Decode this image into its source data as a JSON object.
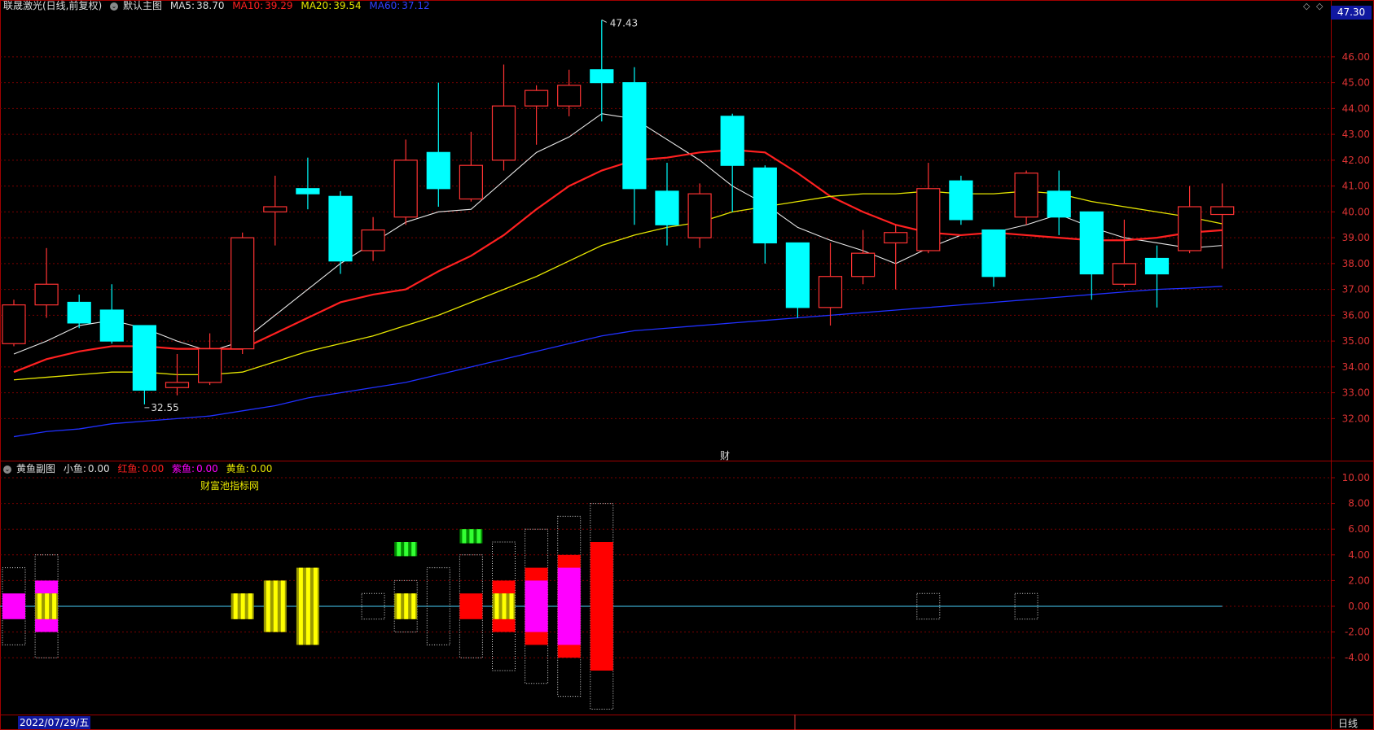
{
  "main_header": {
    "stock": "联晟激光(日线,前复权)",
    "panel": "默认主图",
    "ma5_label": "MA5:",
    "ma5": "38.70",
    "ma10_label": "MA10:",
    "ma10": "39.29",
    "ma20_label": "MA20:",
    "ma20": "39.54",
    "ma60_label": "MA60:",
    "ma60": "37.12"
  },
  "price_box": "47.30",
  "sub_header": {
    "panel": "黄鱼副图",
    "small_label": "小鱼:",
    "small": "0.00",
    "red_label": "红鱼:",
    "red": "0.00",
    "purple_label": "紫鱼:",
    "purple": "0.00",
    "yellow_label": "黄鱼:",
    "yellow": "0.00"
  },
  "sub_note": "财富池指标网",
  "cai_marker": "财",
  "date_label": "2022/07/29/五",
  "period_label": "日线",
  "colors": {
    "up": "#ff3333",
    "down": "#00ffff",
    "ma5": "#e8e8e8",
    "ma10": "#ff2020",
    "ma20": "#e6e600",
    "ma60": "#2030ff",
    "grid": "#7a0000",
    "border": "#a00000",
    "fish_yellow": "#e6e600",
    "fish_magenta": "#ff00ff",
    "fish_red": "#ff0000",
    "fish_green": "#00cc00"
  },
  "chart_data": [
    {
      "type": "candlestick",
      "title": "默认主图",
      "ylim": [
        31.0,
        47.43
      ],
      "y_ticks": [
        "32.00",
        "33.00",
        "34.00",
        "35.00",
        "36.00",
        "37.00",
        "38.00",
        "39.00",
        "40.00",
        "41.00",
        "42.00",
        "43.00",
        "44.00",
        "45.00",
        "46.00"
      ],
      "high_annotation": "47.43",
      "low_annotation": "32.55",
      "candles": [
        {
          "o": 34.9,
          "c": 36.4,
          "h": 36.6,
          "l": 34.8
        },
        {
          "o": 36.4,
          "c": 37.2,
          "h": 38.6,
          "l": 35.9
        },
        {
          "o": 36.5,
          "c": 35.7,
          "h": 36.8,
          "l": 35.5
        },
        {
          "o": 36.2,
          "c": 35.0,
          "h": 37.2,
          "l": 34.9
        },
        {
          "o": 35.6,
          "c": 33.1,
          "h": 35.6,
          "l": 32.55
        },
        {
          "o": 33.2,
          "c": 33.4,
          "h": 34.5,
          "l": 32.9
        },
        {
          "o": 33.4,
          "c": 34.7,
          "h": 35.3,
          "l": 33.3
        },
        {
          "o": 34.7,
          "c": 39.0,
          "h": 39.2,
          "l": 34.5
        },
        {
          "o": 40.0,
          "c": 40.2,
          "h": 41.4,
          "l": 38.7
        },
        {
          "o": 40.9,
          "c": 40.7,
          "h": 42.1,
          "l": 40.1
        },
        {
          "o": 40.6,
          "c": 38.1,
          "h": 40.8,
          "l": 37.6
        },
        {
          "o": 38.5,
          "c": 39.3,
          "h": 39.8,
          "l": 38.1
        },
        {
          "o": 39.8,
          "c": 42.0,
          "h": 42.8,
          "l": 39.5
        },
        {
          "o": 42.3,
          "c": 40.9,
          "h": 45.0,
          "l": 40.2
        },
        {
          "o": 40.5,
          "c": 41.8,
          "h": 43.1,
          "l": 40.4
        },
        {
          "o": 42.0,
          "c": 44.1,
          "h": 45.7,
          "l": 41.6
        },
        {
          "o": 44.1,
          "c": 44.7,
          "h": 44.9,
          "l": 42.6
        },
        {
          "o": 44.1,
          "c": 44.9,
          "h": 45.5,
          "l": 43.7
        },
        {
          "o": 45.5,
          "c": 45.0,
          "h": 47.43,
          "l": 43.5
        },
        {
          "o": 45.0,
          "c": 40.9,
          "h": 45.6,
          "l": 39.5
        },
        {
          "o": 40.8,
          "c": 39.5,
          "h": 41.9,
          "l": 38.7
        },
        {
          "o": 39.0,
          "c": 40.7,
          "h": 41.1,
          "l": 38.6
        },
        {
          "o": 43.7,
          "c": 41.8,
          "h": 43.8,
          "l": 40.0
        },
        {
          "o": 41.7,
          "c": 38.8,
          "h": 41.8,
          "l": 38.0
        },
        {
          "o": 38.8,
          "c": 36.3,
          "h": 38.8,
          "l": 35.9
        },
        {
          "o": 36.3,
          "c": 37.5,
          "h": 38.8,
          "l": 35.6
        },
        {
          "o": 37.5,
          "c": 38.4,
          "h": 39.3,
          "l": 37.2
        },
        {
          "o": 38.8,
          "c": 39.2,
          "h": 39.5,
          "l": 37.0
        },
        {
          "o": 38.5,
          "c": 40.9,
          "h": 41.9,
          "l": 38.4
        },
        {
          "o": 41.2,
          "c": 39.7,
          "h": 41.4,
          "l": 39.5
        },
        {
          "o": 39.3,
          "c": 37.5,
          "h": 39.3,
          "l": 37.1
        },
        {
          "o": 39.8,
          "c": 41.5,
          "h": 41.6,
          "l": 39.5
        },
        {
          "o": 40.8,
          "c": 39.8,
          "h": 41.6,
          "l": 39.1
        },
        {
          "o": 40.0,
          "c": 37.6,
          "h": 40.0,
          "l": 36.6
        },
        {
          "o": 37.2,
          "c": 38.0,
          "h": 39.7,
          "l": 37.1
        },
        {
          "o": 38.2,
          "c": 37.6,
          "h": 38.7,
          "l": 36.3
        },
        {
          "o": 38.5,
          "c": 40.2,
          "h": 41.0,
          "l": 38.4
        },
        {
          "o": 39.9,
          "c": 40.2,
          "h": 41.1,
          "l": 37.8
        }
      ],
      "series": [
        {
          "name": "MA5",
          "key": "ma5",
          "values": [
            34.5,
            35.0,
            35.6,
            35.8,
            35.5,
            35.0,
            34.6,
            35.0,
            36.0,
            37.0,
            38.0,
            38.8,
            39.6,
            40.0,
            40.1,
            41.2,
            42.3,
            42.9,
            43.8,
            43.6,
            42.8,
            42.0,
            41.0,
            40.3,
            39.4,
            38.9,
            38.5,
            38.0,
            38.6,
            39.1,
            39.2,
            39.5,
            39.9,
            39.4,
            39.0,
            38.8,
            38.6,
            38.7
          ]
        },
        {
          "name": "MA10",
          "key": "ma10",
          "values": [
            33.8,
            34.3,
            34.6,
            34.8,
            34.8,
            34.7,
            34.7,
            34.7,
            35.3,
            35.9,
            36.5,
            36.8,
            37.0,
            37.7,
            38.3,
            39.1,
            40.1,
            41.0,
            41.6,
            42.0,
            42.1,
            42.3,
            42.4,
            42.3,
            41.5,
            40.6,
            40.0,
            39.5,
            39.2,
            39.1,
            39.2,
            39.1,
            39.0,
            38.9,
            38.9,
            39.0,
            39.2,
            39.29
          ]
        },
        {
          "name": "MA20",
          "key": "ma20",
          "values": [
            33.5,
            33.6,
            33.7,
            33.8,
            33.8,
            33.7,
            33.7,
            33.8,
            34.2,
            34.6,
            34.9,
            35.2,
            35.6,
            36.0,
            36.5,
            37.0,
            37.5,
            38.1,
            38.7,
            39.1,
            39.4,
            39.6,
            40.0,
            40.2,
            40.4,
            40.6,
            40.7,
            40.7,
            40.8,
            40.7,
            40.7,
            40.8,
            40.7,
            40.4,
            40.2,
            40.0,
            39.8,
            39.54
          ]
        },
        {
          "name": "MA60",
          "key": "ma60",
          "values": [
            31.3,
            31.5,
            31.6,
            31.8,
            31.9,
            32.0,
            32.1,
            32.3,
            32.5,
            32.8,
            33.0,
            33.2,
            33.4,
            33.7,
            34.0,
            34.3,
            34.6,
            34.9,
            35.2,
            35.4,
            35.5,
            35.6,
            35.7,
            35.8,
            35.9,
            36.0,
            36.1,
            36.2,
            36.3,
            36.4,
            36.5,
            36.6,
            36.7,
            36.8,
            36.9,
            37.0,
            37.05,
            37.12
          ]
        }
      ]
    },
    {
      "type": "bar",
      "title": "黄鱼副图",
      "ylim": [
        -6.5,
        11.5
      ],
      "y_ticks": [
        "-4.00",
        "-2.00",
        "0.00",
        "2.00",
        "4.00",
        "6.00",
        "8.00",
        "10.00"
      ],
      "bars": [
        {
          "i": 0,
          "dotted": 3,
          "segs": [
            {
              "c": "fish_magenta",
              "a": -1,
              "b": 1
            }
          ]
        },
        {
          "i": 1,
          "dotted": 4,
          "segs": [
            {
              "c": "fish_magenta",
              "a": -2,
              "b": 2
            },
            {
              "c": "fish_yellow",
              "a": -1,
              "b": 1
            }
          ]
        },
        {
          "i": 7,
          "segs": [
            {
              "c": "fish_yellow",
              "a": -1,
              "b": 1
            }
          ]
        },
        {
          "i": 8,
          "segs": [
            {
              "c": "fish_yellow",
              "a": -2,
              "b": 2
            }
          ]
        },
        {
          "i": 9,
          "segs": [
            {
              "c": "fish_yellow",
              "a": -3,
              "b": 3
            }
          ]
        },
        {
          "i": 11,
          "dotted": 1
        },
        {
          "i": 12,
          "dotted": 2,
          "segs": [
            {
              "c": "fish_yellow",
              "a": -1,
              "b": 1
            }
          ],
          "green": [
            3.9,
            5.0
          ]
        },
        {
          "i": 13,
          "dotted": 3
        },
        {
          "i": 14,
          "dotted": 4,
          "segs": [
            {
              "c": "fish_red",
              "a": -1,
              "b": 1
            }
          ],
          "green": [
            4.9,
            6.0
          ]
        },
        {
          "i": 15,
          "dotted": 5,
          "segs": [
            {
              "c": "fish_red",
              "a": -2,
              "b": 2
            },
            {
              "c": "fish_yellow",
              "a": -1,
              "b": 1
            }
          ]
        },
        {
          "i": 16,
          "dotted": 6,
          "segs": [
            {
              "c": "fish_red",
              "a": -3,
              "b": 3
            },
            {
              "c": "fish_magenta",
              "a": -2,
              "b": 2
            }
          ]
        },
        {
          "i": 17,
          "dotted": 7,
          "segs": [
            {
              "c": "fish_red",
              "a": -4,
              "b": 4
            },
            {
              "c": "fish_magenta",
              "a": -3,
              "b": 3
            }
          ]
        },
        {
          "i": 18,
          "dotted": 8,
          "segs": [
            {
              "c": "fish_red",
              "a": -5,
              "b": 5
            }
          ]
        },
        {
          "i": 28,
          "dotted": 1
        },
        {
          "i": 31,
          "dotted": 1
        }
      ]
    }
  ]
}
